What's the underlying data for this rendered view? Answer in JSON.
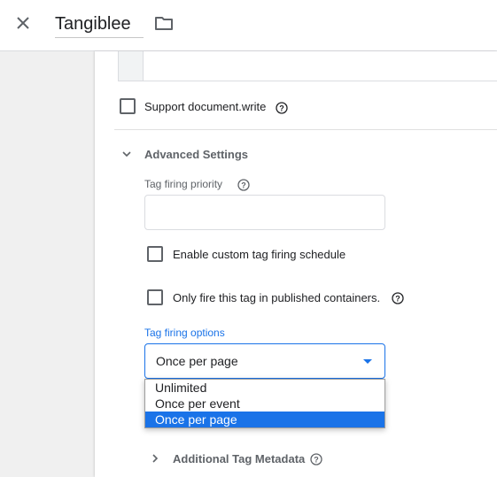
{
  "header": {
    "title": "Tangiblee",
    "close_icon": "close-icon",
    "folder_icon": "folder-icon"
  },
  "settings": {
    "support_document_write": {
      "label": "Support document.write",
      "checked": false
    },
    "advanced": {
      "title": "Advanced Settings",
      "expanded": true,
      "tag_firing_priority": {
        "label": "Tag firing priority",
        "value": ""
      },
      "custom_schedule": {
        "label": "Enable custom tag firing schedule",
        "checked": false
      },
      "published_only": {
        "label": "Only fire this tag in published containers.",
        "checked": false
      },
      "tag_firing_options": {
        "label": "Tag firing options",
        "selected": "Once per page",
        "options": [
          "Unlimited",
          "Once per event",
          "Once per page"
        ]
      }
    },
    "additional_metadata": {
      "title": "Additional Tag Metadata",
      "expanded": false
    }
  },
  "colors": {
    "accent": "#1a73e8",
    "text": "#202124",
    "muted": "#5f6368"
  }
}
